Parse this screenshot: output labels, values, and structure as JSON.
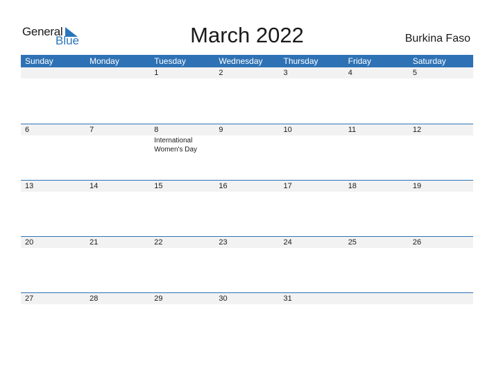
{
  "logo": {
    "word1": "General",
    "word2": "Blue"
  },
  "title": "March 2022",
  "country": "Burkina Faso",
  "colors": {
    "accent": "#2e72b5",
    "band": "#f2f2f2"
  },
  "weekdays": [
    "Sunday",
    "Monday",
    "Tuesday",
    "Wednesday",
    "Thursday",
    "Friday",
    "Saturday"
  ],
  "weeks": [
    [
      {
        "day": ""
      },
      {
        "day": ""
      },
      {
        "day": "1"
      },
      {
        "day": "2"
      },
      {
        "day": "3"
      },
      {
        "day": "4"
      },
      {
        "day": "5"
      }
    ],
    [
      {
        "day": "6"
      },
      {
        "day": "7"
      },
      {
        "day": "8",
        "event": "International Women's Day"
      },
      {
        "day": "9"
      },
      {
        "day": "10"
      },
      {
        "day": "11"
      },
      {
        "day": "12"
      }
    ],
    [
      {
        "day": "13"
      },
      {
        "day": "14"
      },
      {
        "day": "15"
      },
      {
        "day": "16"
      },
      {
        "day": "17"
      },
      {
        "day": "18"
      },
      {
        "day": "19"
      }
    ],
    [
      {
        "day": "20"
      },
      {
        "day": "21"
      },
      {
        "day": "22"
      },
      {
        "day": "23"
      },
      {
        "day": "24"
      },
      {
        "day": "25"
      },
      {
        "day": "26"
      }
    ],
    [
      {
        "day": "27"
      },
      {
        "day": "28"
      },
      {
        "day": "29"
      },
      {
        "day": "30"
      },
      {
        "day": "31"
      },
      {
        "day": ""
      },
      {
        "day": ""
      }
    ]
  ]
}
